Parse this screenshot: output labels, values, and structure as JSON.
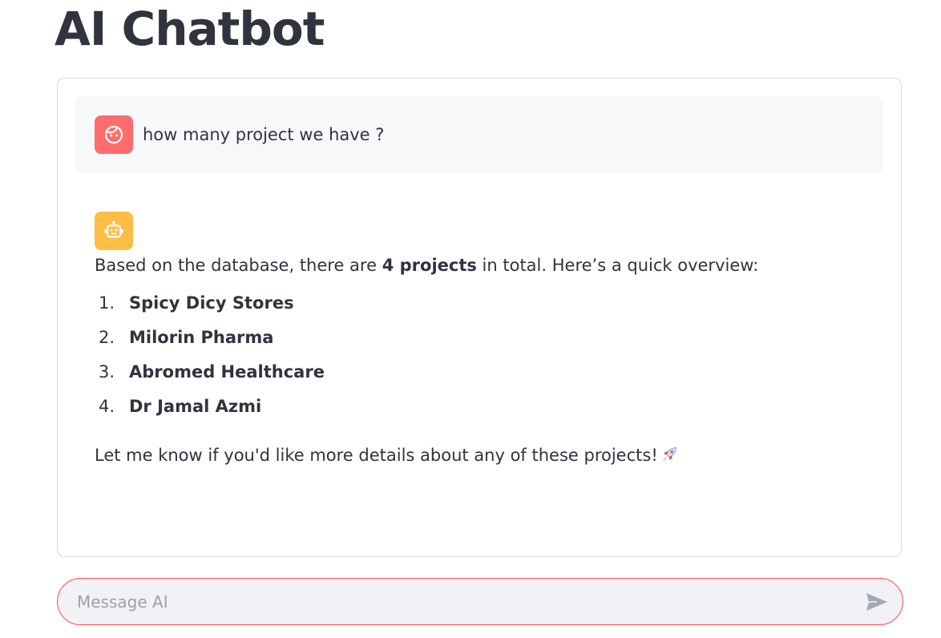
{
  "page": {
    "title": "AI Chatbot"
  },
  "chat": {
    "user_message": {
      "avatar_icon": "face-icon",
      "text": "how many project we have ?"
    },
    "assistant_message": {
      "avatar_icon": "robot-icon",
      "intro_before": "Based on the database, there are ",
      "intro_bold": "4 projects",
      "intro_after": " in total. Here’s a quick overview:",
      "projects": [
        {
          "num": "1.",
          "name": "Spicy Dicy Stores"
        },
        {
          "num": "2.",
          "name": "Milorin Pharma"
        },
        {
          "num": "3.",
          "name": "Abromed Healthcare"
        },
        {
          "num": "4.",
          "name": "Dr Jamal Azmi"
        }
      ],
      "outro": "Let me know if you'd like more details about any of these projects!",
      "outro_emoji_icon": "rocket-icon"
    }
  },
  "input": {
    "placeholder": "Message AI",
    "value": "",
    "send_icon": "send-icon"
  },
  "colors": {
    "user_avatar": "#ff6c6c",
    "assistant_avatar": "#ffbd45",
    "input_border": "#ff4b4b",
    "text": "#31333f"
  }
}
